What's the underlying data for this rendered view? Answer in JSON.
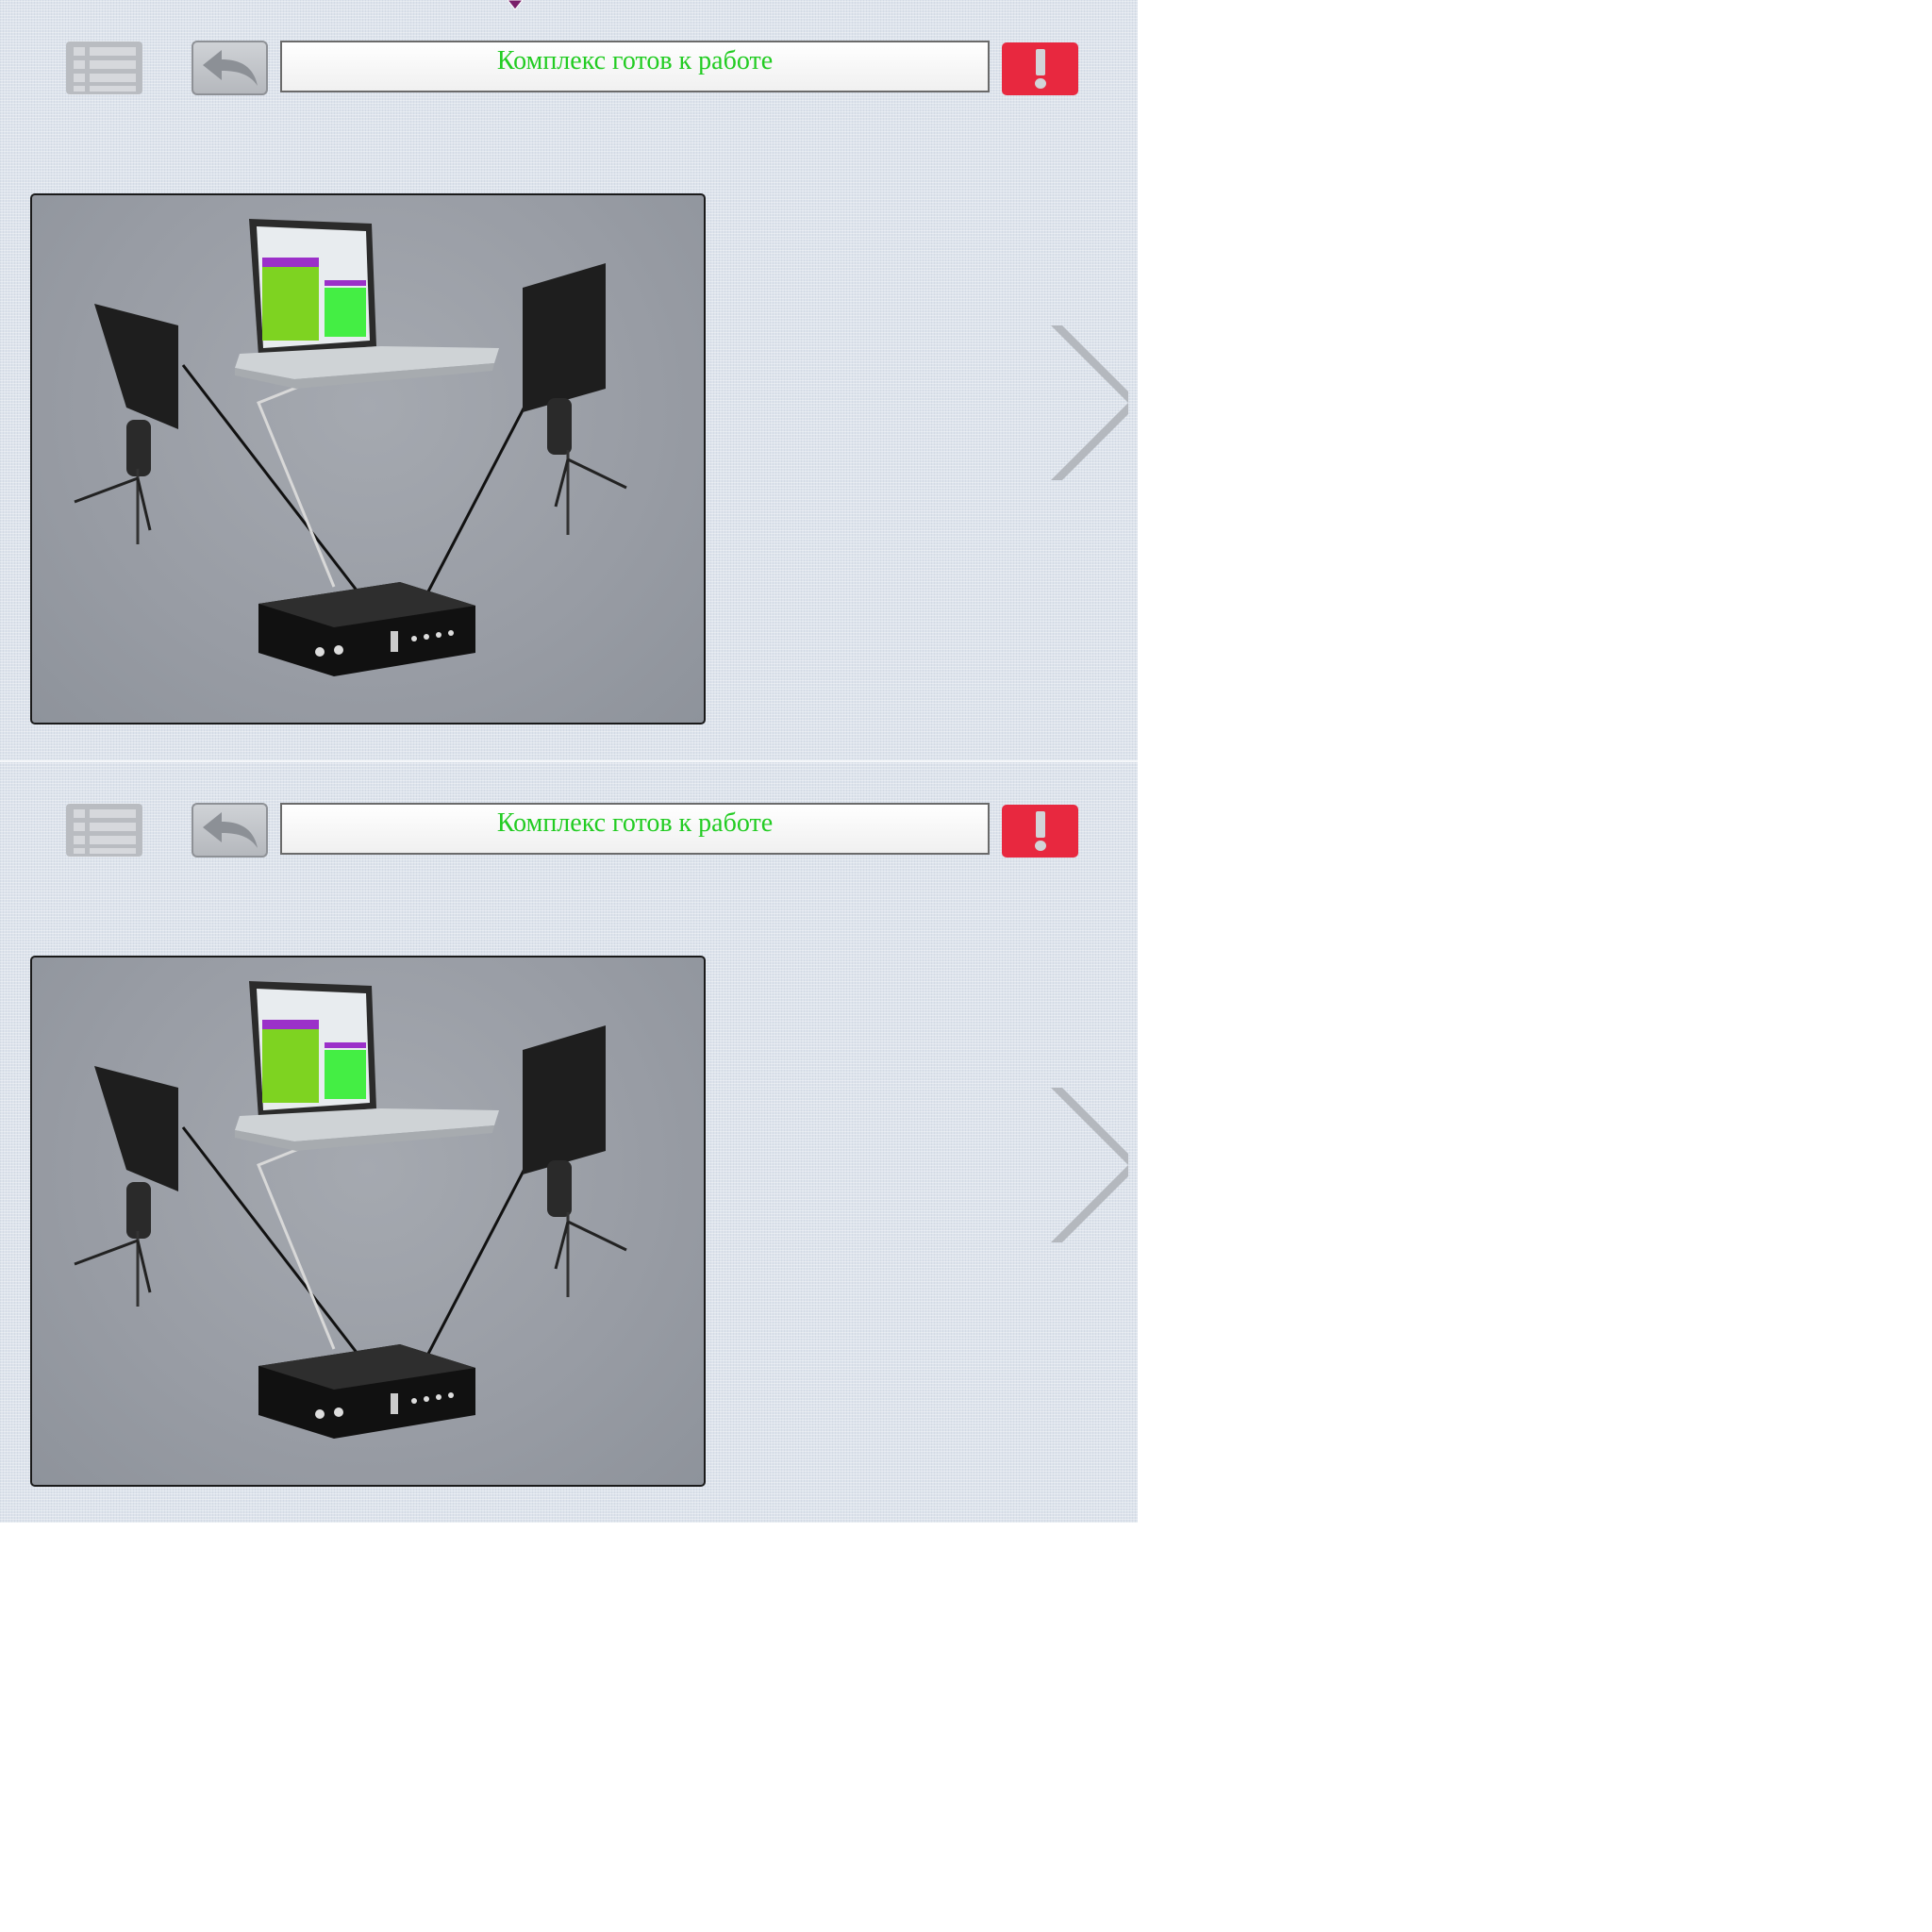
{
  "screens": [
    {
      "status_text": "Комплекс готов к работе",
      "icons": {
        "menu": "list-icon",
        "back": "undo-arrow-icon",
        "alert": "exclamation-icon",
        "next": "chevron-right-icon"
      }
    },
    {
      "status_text": "Комплекс готов к работе",
      "icons": {
        "menu": "list-icon",
        "back": "undo-arrow-icon",
        "alert": "exclamation-icon",
        "next": "chevron-right-icon"
      }
    }
  ],
  "colors": {
    "status_text": "#22cc22",
    "alert_button": "#e8283f",
    "background": "#dde3ec",
    "scene_background": "#989ca4"
  }
}
